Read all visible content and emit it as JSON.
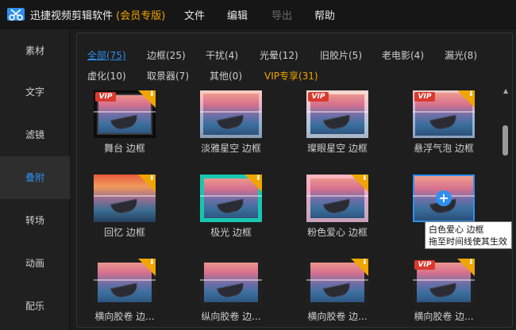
{
  "app": {
    "name": "迅捷视频剪辑软件",
    "edition": "(会员专版)"
  },
  "menu": [
    {
      "label": "文件",
      "disabled": false
    },
    {
      "label": "编辑",
      "disabled": false
    },
    {
      "label": "导出",
      "disabled": true
    },
    {
      "label": "帮助",
      "disabled": false
    }
  ],
  "sidebar": {
    "items": [
      {
        "label": "素材"
      },
      {
        "label": "文字"
      },
      {
        "label": "滤镜"
      },
      {
        "label": "叠附",
        "active": true
      },
      {
        "label": "转场"
      },
      {
        "label": "动画"
      },
      {
        "label": "配乐"
      }
    ]
  },
  "filters": [
    {
      "label": "全部(75)",
      "active": true
    },
    {
      "label": "边框(25)"
    },
    {
      "label": "干扰(4)"
    },
    {
      "label": "光晕(12)"
    },
    {
      "label": "旧胶片(5)"
    },
    {
      "label": "老电影(4)"
    },
    {
      "label": "漏光(8)"
    },
    {
      "label": "虚化(10)"
    },
    {
      "label": "取景器(7)"
    },
    {
      "label": "其他(0)"
    },
    {
      "label": "VIP专享(31)",
      "vip": true
    }
  ],
  "items": [
    {
      "label": "舞台 边框",
      "vip": true,
      "download": true
    },
    {
      "label": "淡雅星空 边框",
      "vip": false,
      "download": false
    },
    {
      "label": "璨眼星空 边框",
      "vip": true,
      "download": false
    },
    {
      "label": "悬浮气泡 边框",
      "vip": true,
      "download": true
    },
    {
      "label": "回忆 边框",
      "vip": false,
      "download": true
    },
    {
      "label": "极光 边框",
      "vip": false,
      "download": true
    },
    {
      "label": "粉色爱心 边框",
      "vip": false,
      "download": true
    },
    {
      "label": "白色爱心 边框",
      "vip": false,
      "download": false,
      "selected": true
    },
    {
      "label": "横向胶卷 边...",
      "vip": false,
      "download": true
    },
    {
      "label": "纵向胶卷 边...",
      "vip": false,
      "download": false
    },
    {
      "label": "横向胶卷 边...",
      "vip": false,
      "download": true
    },
    {
      "label": "横向胶卷 边...",
      "vip": true,
      "download": true
    }
  ],
  "tooltip": {
    "line1": "白色爱心 边框",
    "line2": "拖至时间线使其生效"
  },
  "icons": {
    "logo": "scissors-film-icon",
    "add": "plus-circle-icon",
    "download": "download-corner-icon"
  },
  "colors": {
    "accent": "#2f8ff0",
    "vip": "#f0a500",
    "vip_badge": "#d93a2e"
  }
}
